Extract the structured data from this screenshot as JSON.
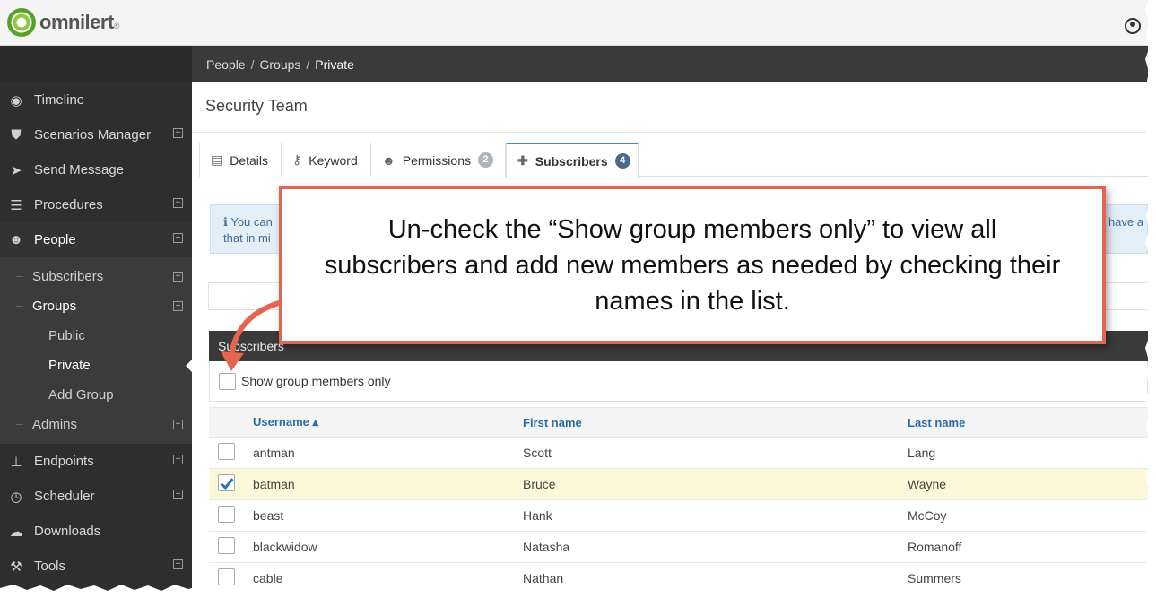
{
  "brand": {
    "name": "omnilert",
    "trademark": "®"
  },
  "breadcrumb": [
    "People",
    "Groups",
    "Private"
  ],
  "sidebar": {
    "items": [
      {
        "label": "Timeline",
        "icon": "timeline-icon",
        "expander": ""
      },
      {
        "label": "Scenarios Manager",
        "icon": "shield-icon",
        "expander": "⊞"
      },
      {
        "label": "Send Message",
        "icon": "paper-plane-icon",
        "expander": ""
      },
      {
        "label": "Procedures",
        "icon": "list-icon",
        "expander": "⊞"
      },
      {
        "label": "People",
        "icon": "people-icon",
        "expander": "⊟"
      }
    ],
    "people_sub": [
      {
        "label": "Subscribers",
        "expander": "⊞"
      },
      {
        "label": "Groups",
        "expander": "⊟"
      }
    ],
    "groups_sub": [
      "Public",
      "Private",
      "Add Group"
    ],
    "people_sub_after": {
      "label": "Admins",
      "expander": "⊞"
    },
    "items_after": [
      {
        "label": "Endpoints",
        "icon": "sitemap-icon",
        "expander": "⊞"
      },
      {
        "label": "Scheduler",
        "icon": "clock-icon",
        "expander": "⊞"
      },
      {
        "label": "Downloads",
        "icon": "cloud-download-icon",
        "expander": ""
      },
      {
        "label": "Tools",
        "icon": "wrench-icon",
        "expander": "⊞"
      }
    ]
  },
  "page": {
    "title": "Security Team"
  },
  "tabs": [
    {
      "label": "Details",
      "icon": "details-icon",
      "badge": ""
    },
    {
      "label": "Keyword",
      "icon": "key-icon",
      "badge": ""
    },
    {
      "label": "Permissions",
      "icon": "users-icon",
      "badge": "2"
    },
    {
      "label": "Subscribers",
      "icon": "user-plus-icon",
      "badge": "4"
    }
  ],
  "info": {
    "line1": "You can",
    "line2": "that in mi",
    "right": "have a"
  },
  "panel": {
    "title": "Subscribers",
    "filter_label": "Show group members only",
    "filter_checked": false
  },
  "table": {
    "headers": {
      "username": "Username ▴",
      "first": "First name",
      "last": "Last name"
    },
    "rows": [
      {
        "username": "antman",
        "first": "Scott",
        "last": "Lang",
        "checked": false
      },
      {
        "username": "batman",
        "first": "Bruce",
        "last": "Wayne",
        "checked": true
      },
      {
        "username": "beast",
        "first": "Hank",
        "last": "McCoy",
        "checked": false
      },
      {
        "username": "blackwidow",
        "first": "Natasha",
        "last": "Romanoff",
        "checked": false
      },
      {
        "username": "cable",
        "first": "Nathan",
        "last": "Summers",
        "checked": false
      }
    ]
  },
  "callout": {
    "text": "Un-check the “Show group members only” to view all subscribers and add new members as needed by checking their names in the list."
  },
  "colors": {
    "callout_border": "#e26451",
    "link_blue": "#2e6da4",
    "sidebar": "#2e2e2e",
    "highlight_row": "#fbf8d9"
  }
}
